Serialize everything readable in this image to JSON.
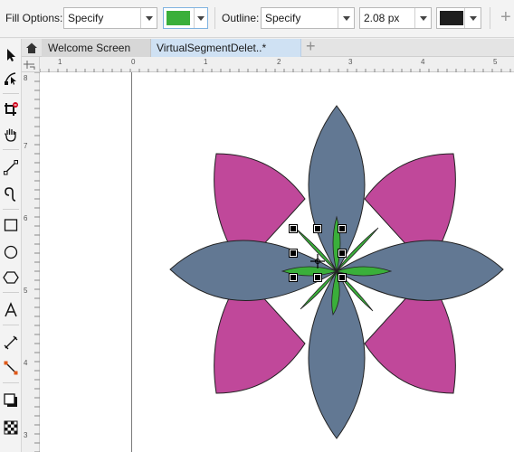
{
  "propbar": {
    "fill_label": "Fill Options:",
    "fill_value": "Specify",
    "fill_color": "#3aaf3a",
    "outline_label": "Outline:",
    "outline_value": "Specify",
    "outline_width": "2.08 px",
    "outline_color": "#1e1e1e",
    "add_icon": "plus-icon"
  },
  "toolbox": {
    "tools": [
      "pick-tool-icon",
      "shape-tool-icon",
      "crop-tool-icon",
      "pan-tool-icon",
      "freehand-tool-icon",
      "artistic-media-icon",
      "rectangle-tool-icon",
      "ellipse-tool-icon",
      "polygon-tool-icon",
      "text-tool-icon",
      "dimension-tool-icon",
      "connector-tool-icon",
      "drop-shadow-icon",
      "transparency-icon"
    ]
  },
  "tabs": {
    "home_icon": "home-icon",
    "welcome": "Welcome Screen",
    "document": "VirtualSegmentDelet..*",
    "add_icon": "plus-icon"
  },
  "rulers": {
    "h_labels": [
      "1",
      "0",
      "1",
      "2",
      "3",
      "4",
      "5"
    ],
    "v_labels": [
      "8",
      "7",
      "6",
      "5",
      "4",
      "3"
    ]
  },
  "drawing": {
    "back_petal_color": "#c0489a",
    "front_petal_color": "#627893",
    "leaf_color": "#3aaf3a",
    "outline_color": "#222222"
  }
}
